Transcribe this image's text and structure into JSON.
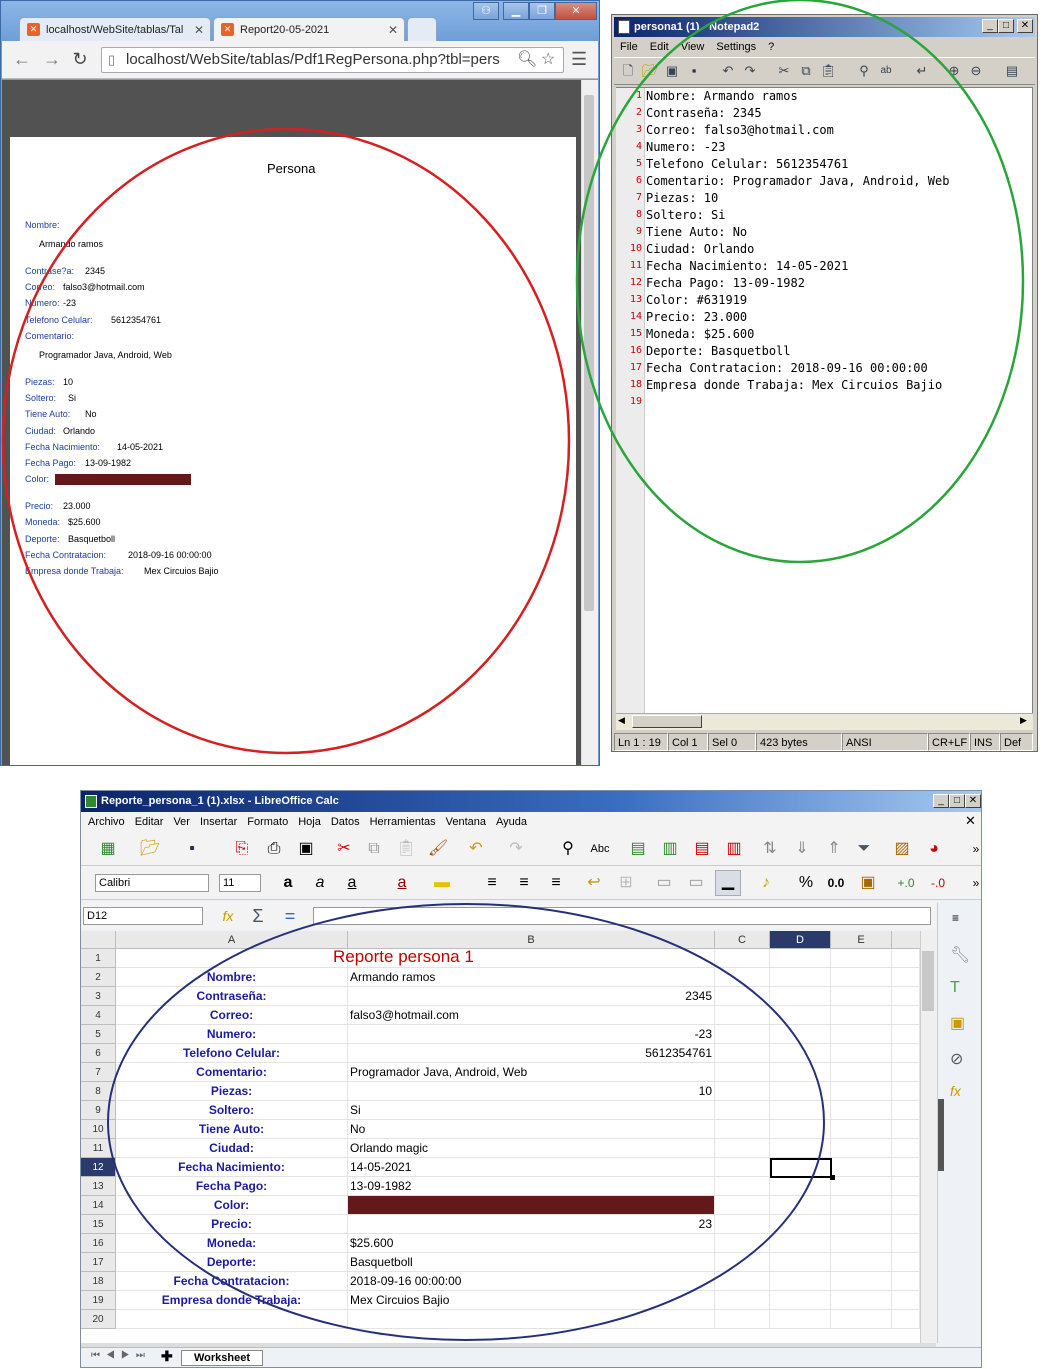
{
  "chrome": {
    "tab1_title": "localhost/WebSite/tablas/Tal",
    "tab2_title": "Report20-05-2021",
    "url": "localhost/WebSite/tablas/Pdf1RegPersona.php?tbl=pers",
    "pdf": {
      "title": "Persona",
      "nombre_label": "Nombre:",
      "nombre_value": "Armando ramos",
      "contrasena_label": "Contrase?a:",
      "contrasena_value": "2345",
      "correo_label": "Correo:",
      "correo_value": "falso3@hotmail.com",
      "numero_label": "Numero:",
      "numero_value": "-23",
      "telefono_label": "Telefono Celular:",
      "telefono_value": "5612354761",
      "comentario_label": "Comentario:",
      "comentario_value": "Programador Java, Android, Web",
      "piezas_label": "Piezas:",
      "piezas_value": "10",
      "soltero_label": "Soltero:",
      "soltero_value": "Si",
      "tieneauto_label": "Tiene Auto:",
      "tieneauto_value": "No",
      "ciudad_label": "Ciudad:",
      "ciudad_value": "Orlando",
      "fechanac_label": "Fecha Nacimiento:",
      "fechanac_value": "14-05-2021",
      "fechapago_label": "Fecha Pago:",
      "fechapago_value": "13-09-1982",
      "color_label": "Color:",
      "precio_label": "Precio:",
      "precio_value": "23.000",
      "moneda_label": "Moneda:",
      "moneda_value": "$25.600",
      "deporte_label": "Deporte:",
      "deporte_value": "Basquetboll",
      "fechacont_label": "Fecha Contratacion:",
      "fechacont_value": "2018-09-16 00:00:00",
      "empresa_label": "Empresa donde Trabaja:",
      "empresa_value": "Mex Circuios Bajio"
    }
  },
  "notepad": {
    "title": "persona1 (1) - Notepad2",
    "menu": [
      "File",
      "Edit",
      "View",
      "Settings",
      "?"
    ],
    "lines": [
      "Nombre: Armando ramos",
      "Contraseña: 2345",
      "Correo: falso3@hotmail.com",
      "Numero: -23",
      "Telefono Celular: 5612354761",
      "Comentario: Programador Java, Android, Web",
      "Piezas: 10",
      "Soltero: Si",
      "Tiene Auto: No",
      "Ciudad: Orlando",
      "Fecha Nacimiento: 14-05-2021",
      "Fecha Pago: 13-09-1982",
      "Color: #631919",
      "Precio: 23.000",
      "Moneda: $25.600",
      "Deporte: Basquetboll",
      "Fecha Contratacion: 2018-09-16 00:00:00",
      "Empresa donde Trabaja: Mex Circuios Bajio",
      ""
    ],
    "status": {
      "pos": "Ln 1 : 19",
      "col": "Col 1",
      "sel": "Sel 0",
      "size": "423 bytes",
      "enc": "ANSI",
      "eol": "CR+LF",
      "ins": "INS",
      "def": "Def"
    }
  },
  "calc": {
    "title": "Reporte_persona_1 (1).xlsx - LibreOffice Calc",
    "menu": [
      "Archivo",
      "Editar",
      "Ver",
      "Insertar",
      "Formato",
      "Hoja",
      "Datos",
      "Herramientas",
      "Ventana",
      "Ayuda"
    ],
    "font_name": "Calibri",
    "font_size": "11",
    "name_box": "D12",
    "columns": [
      "A",
      "B",
      "C",
      "D",
      "E"
    ],
    "report_title": "Reporte persona 1",
    "rows": [
      {
        "n": "1",
        "label": "",
        "value": "",
        "align": "val"
      },
      {
        "n": "2",
        "label": "Nombre:",
        "value": "Armando ramos",
        "align": "val"
      },
      {
        "n": "3",
        "label": "Contraseña:",
        "value": "2345",
        "align": "num"
      },
      {
        "n": "4",
        "label": "Correo:",
        "value": "falso3@hotmail.com",
        "align": "val"
      },
      {
        "n": "5",
        "label": "Numero:",
        "value": "-23",
        "align": "num"
      },
      {
        "n": "6",
        "label": "Telefono Celular:",
        "value": "5612354761",
        "align": "num"
      },
      {
        "n": "7",
        "label": "Comentario:",
        "value": "Programador Java, Android, Web",
        "align": "val"
      },
      {
        "n": "8",
        "label": "Piezas:",
        "value": "10",
        "align": "num"
      },
      {
        "n": "9",
        "label": "Soltero:",
        "value": "Si",
        "align": "val"
      },
      {
        "n": "10",
        "label": "Tiene Auto:",
        "value": "No",
        "align": "val"
      },
      {
        "n": "11",
        "label": "Ciudad:",
        "value": "Orlando magic",
        "align": "val"
      },
      {
        "n": "12",
        "label": "Fecha Nacimiento:",
        "value": "14-05-2021",
        "align": "val"
      },
      {
        "n": "13",
        "label": "Fecha Pago:",
        "value": "13-09-1982",
        "align": "val"
      },
      {
        "n": "14",
        "label": "Color:",
        "value": "",
        "align": "color"
      },
      {
        "n": "15",
        "label": "Precio:",
        "value": "23",
        "align": "num"
      },
      {
        "n": "16",
        "label": "Moneda:",
        "value": "$25.600",
        "align": "val"
      },
      {
        "n": "17",
        "label": "Deporte:",
        "value": "Basquetboll",
        "align": "val"
      },
      {
        "n": "18",
        "label": "Fecha Contratacion:",
        "value": "2018-09-16 00:00:00",
        "align": "val"
      },
      {
        "n": "19",
        "label": "Empresa donde Trabaja:",
        "value": "Mex Circuios Bajio",
        "align": "val"
      },
      {
        "n": "20",
        "label": "",
        "value": "",
        "align": "val"
      }
    ],
    "sheet_tab": "Worksheet"
  },
  "colors": {
    "swatch": "#631919",
    "label_blue": "#1b1ba0",
    "title_red": "#c00000"
  }
}
